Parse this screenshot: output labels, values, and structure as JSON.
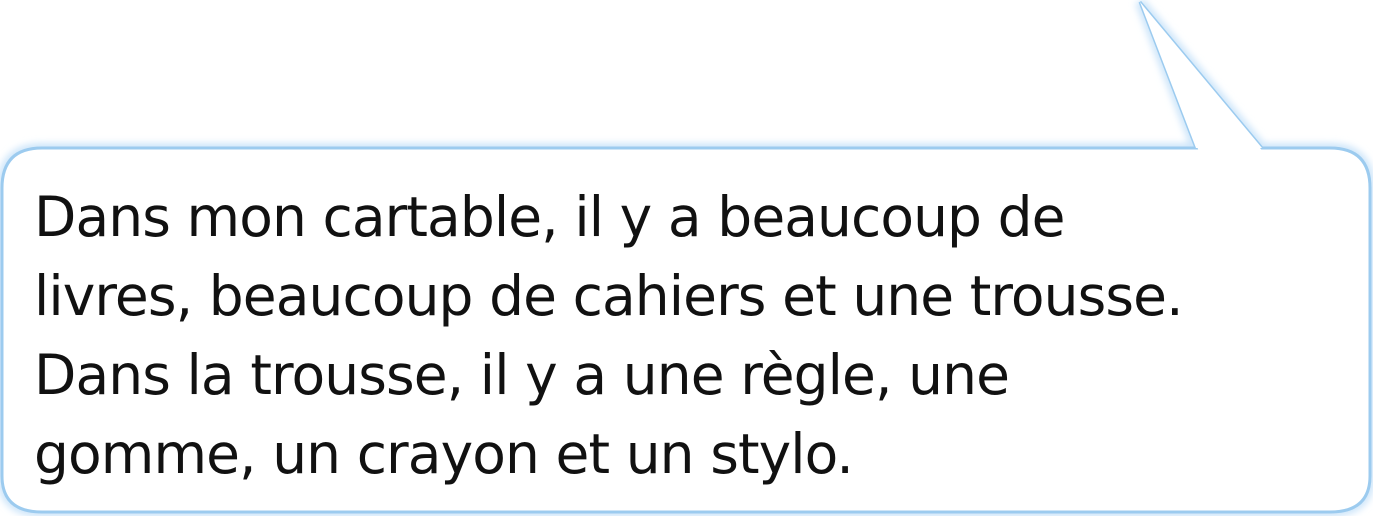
{
  "speech_bubble": {
    "lines": [
      "Dans mon cartable, il y a beaucoup de",
      "livres, beaucoup de cahiers et une trousse.",
      "Dans la trousse, il y a une règle, une",
      "gomme, un crayon et un stylo."
    ]
  },
  "colors": {
    "bubble_fill": "#ffffff",
    "bubble_border": "#9ccbef",
    "bubble_glow": "#cfe6fa",
    "text": "#111111"
  }
}
